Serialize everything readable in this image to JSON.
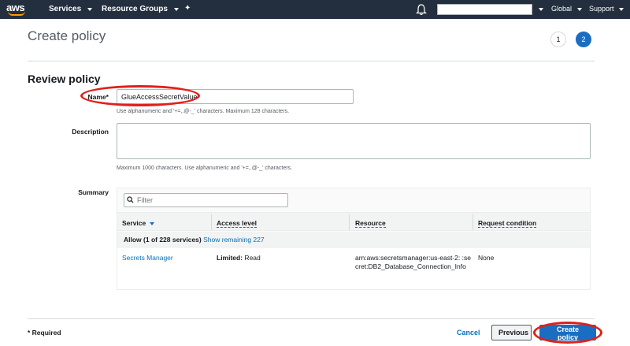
{
  "topnav": {
    "logo_text": "aws",
    "services_label": "Services",
    "resource_groups_label": "Resource Groups",
    "pin_glyph": "✦",
    "region_label": "Global",
    "support_label": "Support"
  },
  "page": {
    "title": "Create policy",
    "steps": [
      "1",
      "2"
    ],
    "section_title": "Review policy"
  },
  "form": {
    "name_label": "Name*",
    "name_value": "GlueAccessSecretValue",
    "name_hint": "Use alphanumeric and '+=,.@-_' characters. Maximum 128 characters.",
    "description_label": "Description",
    "description_value": "",
    "description_hint": "Maximum 1000 characters. Use alphanumeric and '+=,.@-_' characters.",
    "summary_label": "Summary"
  },
  "summary": {
    "filter_placeholder": "Filter",
    "columns": [
      "Service",
      "Access level",
      "Resource",
      "Request condition"
    ],
    "group_text": "Allow (1 of 228 services)",
    "group_link": "Show remaining 227",
    "rows": [
      {
        "service": "Secrets Manager",
        "access_bold": "Limited:",
        "access_rest": " Read",
        "resource": "arn:aws:secretsmanager:us-east-2:            :secret:DB2_Database_Connection_Info",
        "condition": "None"
      }
    ]
  },
  "footer": {
    "required_label": "* Required",
    "cancel_label": "Cancel",
    "previous_label": "Previous",
    "create_label": "Create policy"
  },
  "colors": {
    "nav_bg": "#232f3e",
    "accent": "#ff9900",
    "primary": "#1a6ec2",
    "link": "#0073bb",
    "highlight": "#e0201b"
  }
}
